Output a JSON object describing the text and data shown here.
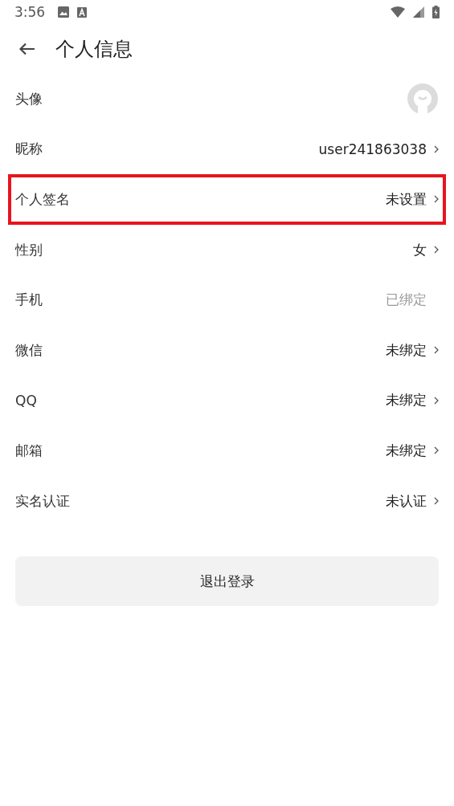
{
  "status_bar": {
    "time": "3:56"
  },
  "header": {
    "title": "个人信息"
  },
  "rows": [
    {
      "kind": "avatar",
      "label": "头像",
      "highlighted": false
    },
    {
      "kind": "value",
      "label": "昵称",
      "value": "user241863038",
      "highlighted": false,
      "disabled": false
    },
    {
      "kind": "value",
      "label": "个人签名",
      "value": "未设置",
      "highlighted": true,
      "disabled": false
    },
    {
      "kind": "value",
      "label": "性别",
      "value": "女",
      "highlighted": false,
      "disabled": false
    },
    {
      "kind": "value",
      "label": "手机",
      "value": "已绑定",
      "highlighted": false,
      "disabled": true
    },
    {
      "kind": "value",
      "label": "微信",
      "value": "未绑定",
      "highlighted": false,
      "disabled": false
    },
    {
      "kind": "value",
      "label": "QQ",
      "value": "未绑定",
      "highlighted": false,
      "disabled": false
    },
    {
      "kind": "value",
      "label": "邮箱",
      "value": "未绑定",
      "highlighted": false,
      "disabled": false
    },
    {
      "kind": "value",
      "label": "实名认证",
      "value": "未认证",
      "highlighted": false,
      "disabled": false
    }
  ],
  "logout_button": "退出登录"
}
